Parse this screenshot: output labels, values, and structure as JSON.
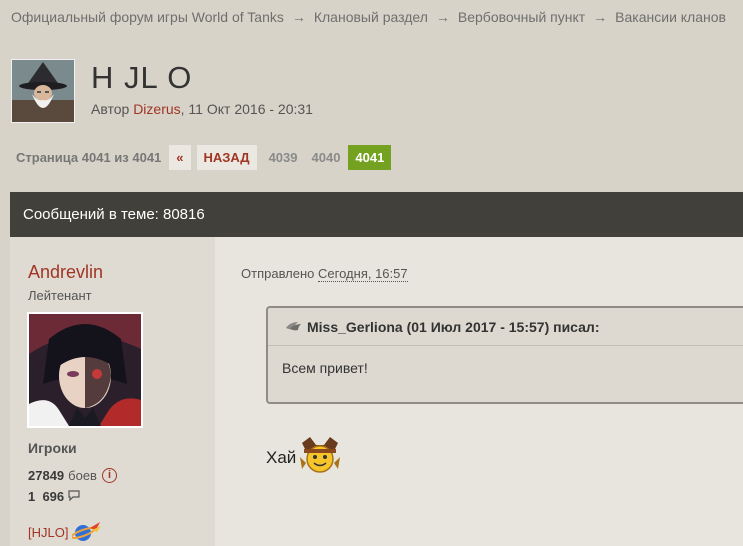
{
  "breadcrumb": [
    "Официальный форум игры World of Tanks",
    "Клановый раздел",
    "Вербовочный пункт",
    "Вакансии кланов"
  ],
  "breadcrumb_separator": "→",
  "topic": {
    "title": "H JL O",
    "author_prefix": "Автор",
    "author": "Dizerus",
    "date": ", 11 Окт 2016 - 20:31"
  },
  "pagination": {
    "info": "Страница 4041 из 4041",
    "first": "«",
    "back": "НАЗАД",
    "pages": [
      "4039",
      "4040"
    ],
    "current": "4041"
  },
  "topic_bar": {
    "posts_count": "Сообщений в теме: 80816"
  },
  "post": {
    "user": {
      "name": "Andrevlin",
      "rank": "Лейтенант",
      "group": "Игроки",
      "battles_count": "27849",
      "battles_label": "боев",
      "posts_count": "1  696",
      "clan": "[HJLO]"
    },
    "date_prefix": "Отправлено",
    "date": "Сегодня, 16:57",
    "quote": {
      "header": "Miss_Gerliona (01 Июл 2017 - 15:57) писал:",
      "text": "Всем привет!"
    },
    "text": "Хай"
  },
  "colors": {
    "background": "#d7d3c8",
    "accent_red": "#a13525",
    "current_page_green": "#74a120",
    "topic_bar": "#42403a"
  },
  "icons": [
    "info-icon",
    "comment-icon",
    "clan-emblem-icon",
    "quote-icon",
    "smiley-icon"
  ]
}
